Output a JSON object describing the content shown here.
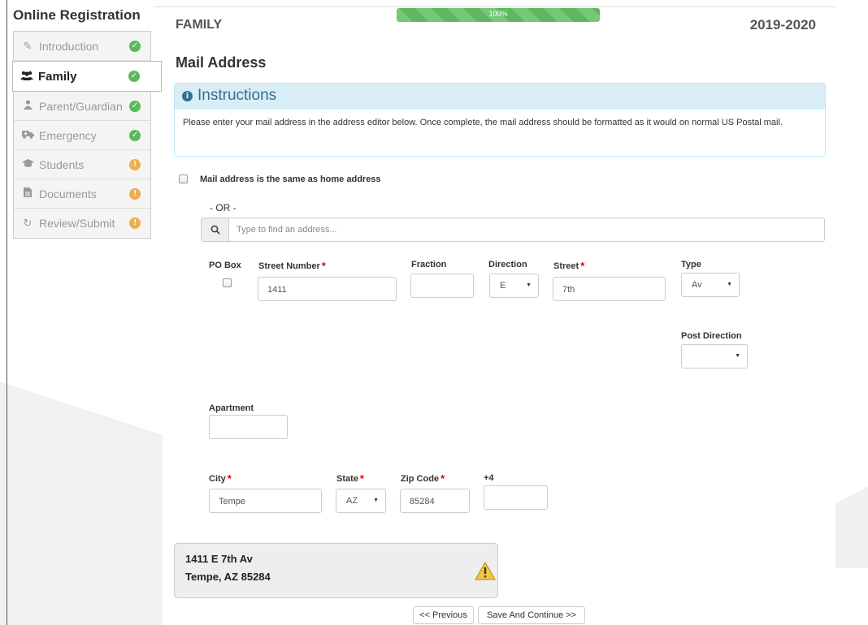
{
  "sidebar": {
    "title": "Online Registration",
    "items": [
      {
        "label": "Introduction",
        "icon": "pencil-icon",
        "status": "complete"
      },
      {
        "label": "Family",
        "icon": "users-icon",
        "status": "complete",
        "active": true
      },
      {
        "label": "Parent/Guardian",
        "icon": "user-icon",
        "status": "complete"
      },
      {
        "label": "Emergency",
        "icon": "ambulance-icon",
        "status": "complete"
      },
      {
        "label": "Students",
        "icon": "graduation-cap-icon",
        "status": "warning"
      },
      {
        "label": "Documents",
        "icon": "file-icon",
        "status": "warning"
      },
      {
        "label": "Review/Submit",
        "icon": "refresh-icon",
        "status": "warning"
      }
    ]
  },
  "header": {
    "section": "FAMILY",
    "progress_label": "100%",
    "progress_value": 1.0,
    "year": "2019-2020"
  },
  "page_title": "Mail Address",
  "instructions": {
    "title": "Instructions",
    "body": "Please enter your mail address in the address editor below. Once complete, the mail address should be formatted as it would on normal US Postal mail."
  },
  "same_as_home": {
    "label": "Mail address is the same as home address",
    "checked": false
  },
  "or_text": "- OR -",
  "search": {
    "placeholder": "Type to find an address..."
  },
  "fields": {
    "po_box": {
      "label": "PO Box",
      "checked": false
    },
    "street_number": {
      "label": "Street Number",
      "value": "1411"
    },
    "fraction": {
      "label": "Fraction",
      "value": ""
    },
    "direction": {
      "label": "Direction",
      "value": "E"
    },
    "street": {
      "label": "Street",
      "value": "7th"
    },
    "type": {
      "label": "Type",
      "value": "Av"
    },
    "post_direction": {
      "label": "Post Direction",
      "value": ""
    },
    "apartment": {
      "label": "Apartment",
      "value": ""
    },
    "city": {
      "label": "City",
      "value": "Tempe"
    },
    "state": {
      "label": "State",
      "value": "AZ"
    },
    "zip": {
      "label": "Zip Code",
      "value": "85284"
    },
    "plus4": {
      "label": "+4",
      "value": ""
    }
  },
  "required_marker": "*",
  "summary": {
    "line1": "1411 E 7th Av",
    "line2": "Tempe, AZ 85284",
    "icon": "warning-icon"
  },
  "buttons": {
    "previous": "<< Previous",
    "save_continue": "Save And Continue >>"
  },
  "colors": {
    "complete": "#5cb85c",
    "warning": "#f0ad4e",
    "info_bg": "#d9edf7",
    "info_text": "#31708f",
    "required": "#e00000"
  }
}
